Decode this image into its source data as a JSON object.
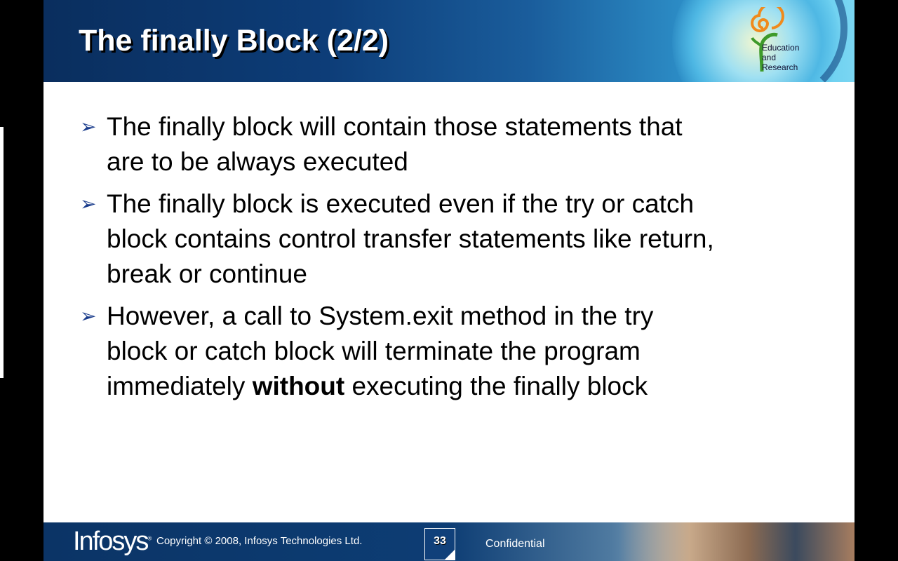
{
  "header": {
    "title": "The finally Block (2/2)",
    "logo_text": [
      "Education",
      "and",
      "Research"
    ]
  },
  "bullets": [
    {
      "lines": [
        "The finally block will contain those statements that",
        "are to be always executed"
      ]
    },
    {
      "lines": [
        "The finally block is executed even if the try or catch",
        "block contains control transfer statements like return,",
        "break or continue"
      ]
    },
    {
      "lines": [
        "However, a call to System.exit method in the try",
        "block or catch block will terminate the program"
      ],
      "last_pre": "immediately ",
      "last_bold": "without",
      "last_post": " executing the finally block"
    }
  ],
  "footer": {
    "brand": "Infosys",
    "registered": "®",
    "copyright": "Copyright © 2008, Infosys Technologies Ltd.",
    "page_number": "33",
    "confidential": "Confidential"
  },
  "colors": {
    "header_dark": "#0a2e5e",
    "bullet_arrow": "#1a3c8c",
    "logo_orange": "#f08a1c",
    "logo_green": "#3e9a2a"
  }
}
